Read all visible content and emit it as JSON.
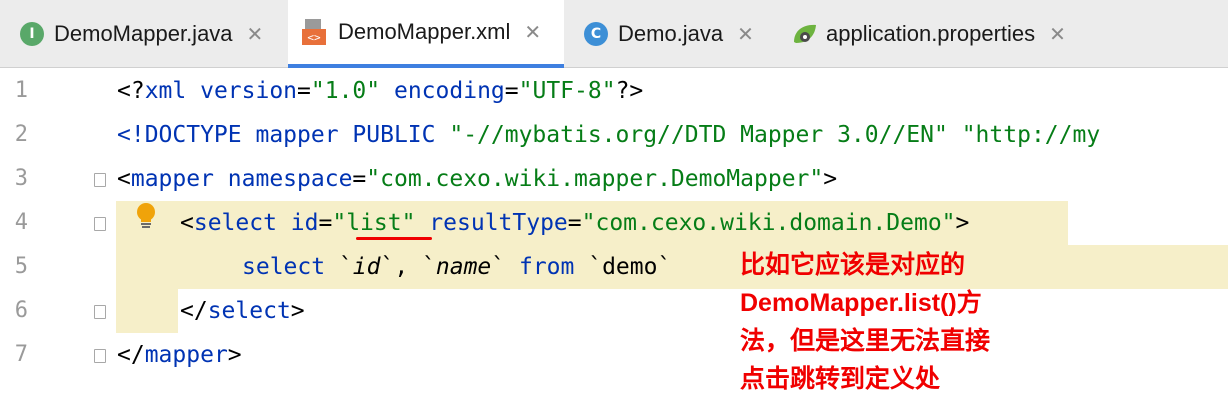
{
  "tabs": [
    {
      "icon": "I",
      "label": "DemoMapper.java",
      "active": false
    },
    {
      "icon": "xml",
      "label": "DemoMapper.xml",
      "active": true
    },
    {
      "icon": "C",
      "label": "Demo.java",
      "active": false
    },
    {
      "icon": "leaf",
      "label": "application.properties",
      "active": false
    }
  ],
  "close_glyph": "✕",
  "editor": {
    "line_numbers": [
      "1",
      "2",
      "3",
      "4",
      "5",
      "6",
      "7"
    ],
    "lines": {
      "l1": [
        "<?",
        "xml version",
        "=",
        "\"1.0\"",
        " encoding",
        "=",
        "\"UTF-8\"",
        "?>"
      ],
      "l2": [
        "<!DOCTYPE mapper PUBLIC ",
        "\"-//mybatis.org//DTD Mapper 3.0//EN\"",
        " ",
        "\"http://my"
      ],
      "l3": [
        "<",
        "mapper ",
        "namespace",
        "=",
        "\"com.cexo.wiki.mapper.DemoMapper\"",
        ">"
      ],
      "l4": [
        "<",
        "select ",
        "id",
        "=",
        "\"list\"",
        " resultType",
        "=",
        "\"com.cexo.wiki.domain.Demo\"",
        ">"
      ],
      "l5": [
        "select ",
        "`",
        "id",
        "`, `",
        "name",
        "` ",
        "from ",
        "`demo`"
      ],
      "l6": [
        "</",
        "select",
        ">"
      ],
      "l7": [
        "</",
        "mapper",
        ">"
      ]
    }
  },
  "annotation": {
    "lines": [
      "比如它应该是对应的",
      "DemoMapper.list()方",
      "法，但是这里无法直接",
      "点击跳转到定义处"
    ],
    "color": "#f00000"
  }
}
